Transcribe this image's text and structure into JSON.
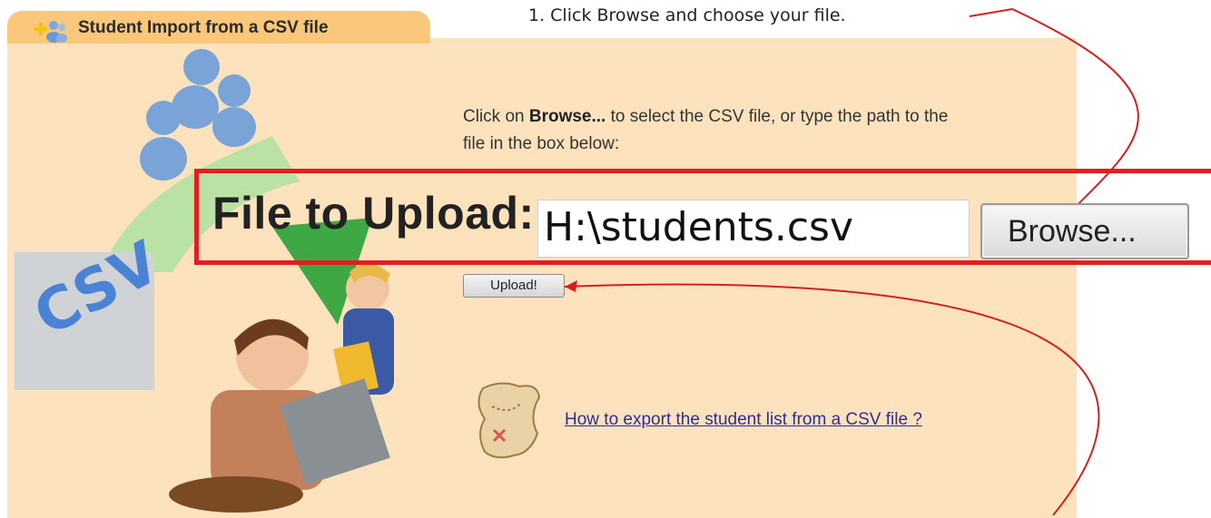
{
  "window": {
    "title": "Student Import from a CSV file"
  },
  "instruction": {
    "step": "1. Click Browse and choose your file."
  },
  "description": {
    "prefix": "Click on ",
    "bold": "Browse...",
    "suffix": " to select the CSV file, or type the path to the file in the box below:"
  },
  "upload_form": {
    "label": "File to Upload:",
    "file_value": "H:\\students.csv",
    "browse_label": "Browse...",
    "upload_label": "Upload!"
  },
  "links": {
    "export_help": "How to export the student list from a CSV file ?"
  },
  "illustration": {
    "csv_label": "CSV"
  },
  "icons": {
    "tab": "add-users-icon",
    "map": "treasure-map-icon",
    "people": "users-icon"
  },
  "colors": {
    "panel_bg": "#fde3bd",
    "tab_bg": "#fbc77a",
    "highlight": "#e02020",
    "link": "#2d2d9a",
    "csv_text": "#4a83d4"
  }
}
